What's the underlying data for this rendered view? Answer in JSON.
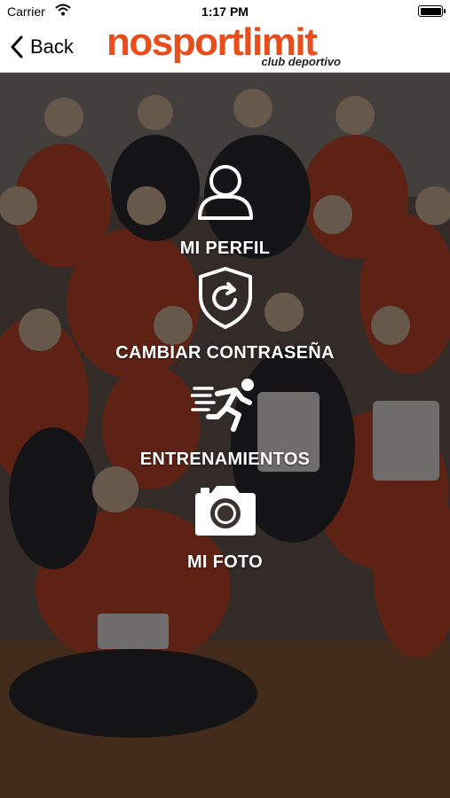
{
  "status_bar": {
    "carrier": "Carrier",
    "time": "1:17 PM"
  },
  "nav": {
    "back_label": "Back",
    "logo": {
      "part1": "nosport",
      "part2": "limit",
      "tagline": "club deportivo"
    }
  },
  "menu": [
    {
      "label": "MI PERFIL",
      "icon": "user-icon"
    },
    {
      "label": "CAMBIAR CONTRASEÑA",
      "icon": "shield-refresh-icon"
    },
    {
      "label": "ENTRENAMIENTOS",
      "icon": "runner-icon"
    },
    {
      "label": "MI FOTO",
      "icon": "camera-icon"
    }
  ],
  "colors": {
    "brand": "#e84e1b",
    "overlay": "#000000",
    "text_on_photo": "#ffffff"
  }
}
